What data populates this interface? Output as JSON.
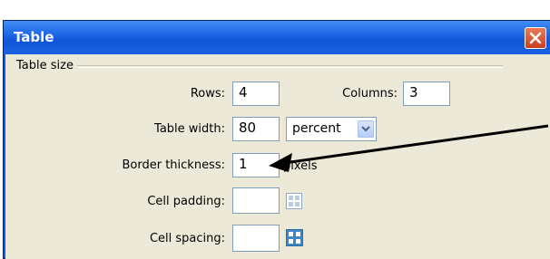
{
  "dialog": {
    "title": "Table",
    "group_label": "Table size",
    "rows_label": "Rows:",
    "rows_value": "4",
    "columns_label": "Columns:",
    "columns_value": "3",
    "width_label": "Table width:",
    "width_value": "80",
    "width_unit": "percent",
    "border_label": "Border thickness:",
    "border_value": "1",
    "border_unit": "pixels",
    "padding_label": "Cell padding:",
    "padding_value": "",
    "spacing_label": "Cell spacing:",
    "spacing_value": ""
  },
  "colors": {
    "title_bar": "#1a62e3",
    "close_button": "#d2502b",
    "dialog_bg": "#ece9d8"
  },
  "icons": [
    "close-icon",
    "chevron-down-icon",
    "cell-padding-icon",
    "cell-spacing-icon"
  ]
}
